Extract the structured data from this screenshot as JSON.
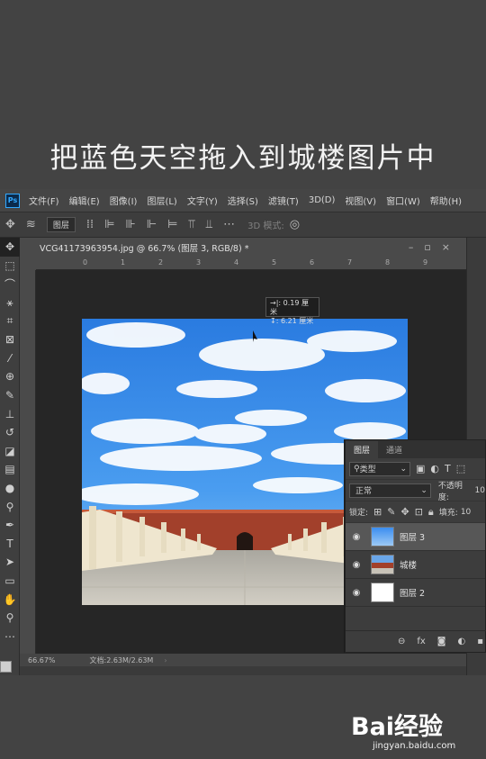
{
  "caption": "把蓝色天空拖入到城楼图片中",
  "app": {
    "logo": "Ps"
  },
  "menu": [
    "文件(F)",
    "编辑(E)",
    "图像(I)",
    "图层(L)",
    "文字(Y)",
    "选择(S)",
    "滤镜(T)",
    "3D(D)",
    "视图(V)",
    "窗口(W)",
    "帮助(H)"
  ],
  "options_bar": {
    "layer_select": "图层",
    "mode3d_label": "3D 模式:"
  },
  "document": {
    "tab_title": "VCG41173963954.jpg @ 66.7% (图层 3, RGB/8) *",
    "ruler_ticks": [
      "0",
      "1",
      "2",
      "3",
      "4",
      "5",
      "6",
      "7",
      "8",
      "9"
    ],
    "zoom": "66.67%",
    "doc_size": "文档:2.63M/2.63M"
  },
  "tooltip": {
    "line1": "→|: 0.19 厘米",
    "line2": "↧: 6.21 厘米"
  },
  "layers_panel": {
    "tabs": [
      "图层",
      "通道"
    ],
    "filter_label": "类型",
    "blend_mode": "正常",
    "opacity_label": "不透明度:",
    "opacity_value": "10",
    "lock_label": "锁定:",
    "fill_label": "填充:",
    "fill_value": "10",
    "layers": [
      {
        "name": "图层 3",
        "selected": true
      },
      {
        "name": "城楼",
        "selected": false
      },
      {
        "name": "图层 2",
        "selected": false
      }
    ]
  },
  "watermark": {
    "brand": "Bai经验",
    "url": "jingyan.baidu.com"
  }
}
